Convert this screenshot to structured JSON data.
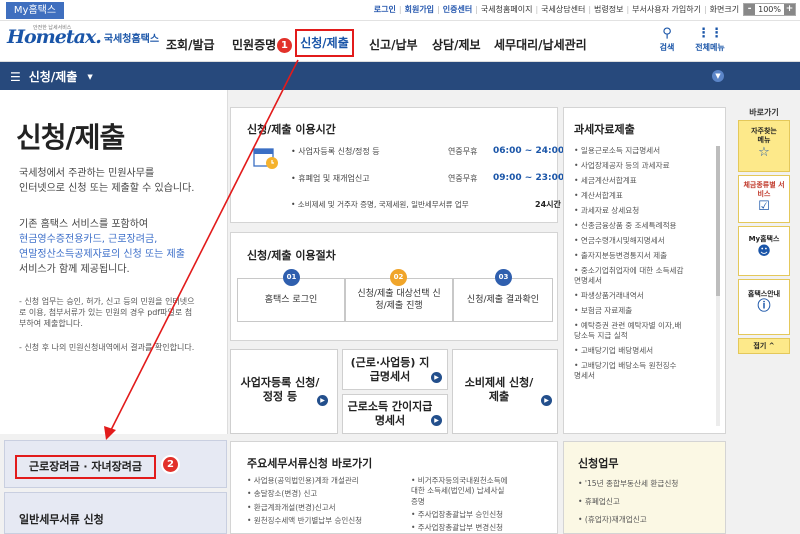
{
  "topbar": {
    "my_hometax": "My홈택스",
    "links": [
      "로그인",
      "회원가입",
      "인증센터",
      "국세청홈페이지",
      "국세상담센터",
      "법령정보",
      "부서사용자 가입하기",
      "화면크기"
    ],
    "zoom": "100%",
    "zoom_minus": "-",
    "zoom_plus": "+"
  },
  "header": {
    "logo_text": "Hometax.",
    "logo_org": "국세청홈택스",
    "logo_tiny": "안전한 납세서비스",
    "nav": [
      "조회/발급",
      "민원증명",
      "신청/제출",
      "신고/납부",
      "상담/제보",
      "세무대리/납세관리"
    ],
    "search_label": "검색",
    "allmenu_label": "전체메뉴"
  },
  "bluebar": {
    "menu_label": "신청/제출",
    "menu_icon": "hamburger-icon"
  },
  "left": {
    "page_title": "신청/제출",
    "intro": [
      "국세청에서 주관하는 민원사무를",
      "인터넷으로 신청 또는 제출할 수 있습니다."
    ],
    "info_line1": "기존 홈택스 서비스를 포함하여",
    "info_blue1": "현금영수증전용카드, 근로장려금,",
    "info_blue2": "연말정산소득공제자료의 신청 또는 제출",
    "info_line4": "서비스가 함께 제공됩니다.",
    "note1_lines": [
      "- 신청 업무는 승인, 허가, 신고 등의 민원을 인터넷으",
      "  로 이용, 첨부서류가 있는 민원의 경우 pdf파일로 첨",
      "  부하여 제출합니다."
    ],
    "note2": "- 신청 후 나의 민원신청내역에서 결과를 확인합니다.",
    "btn_eitc": "근로장려금 · 자녀장려금",
    "btn_general": "일반세무서류 신청"
  },
  "hours": {
    "title": "신청/제출 이용시간",
    "rows": [
      {
        "label": "• 사업자등록 신청/정정 등",
        "pre": "연중무휴",
        "time": "06:00 ~ 24:00"
      },
      {
        "label": "• 휴폐업 및 재개업신고",
        "pre": "연중무휴",
        "time": "09:00 ~ 23:00"
      },
      {
        "label": "• 소비제세 및 거주자 증명, 국제세원, 일반세무서류 업무",
        "time": "24시간"
      }
    ]
  },
  "procedure": {
    "title": "신청/제출 이용절차",
    "steps": [
      {
        "num": "01",
        "text": "홈택스 로그인"
      },
      {
        "num": "02",
        "text": "신청/제출 대상선택 신청/제출 진행"
      },
      {
        "num": "03",
        "text": "신청/제출 결과확인"
      }
    ]
  },
  "quick": {
    "biz_reg": "사업자등록 신청/정정 등",
    "wage_stmt": "(근로·사업등) 지급명세서",
    "simple_stmt": "근로소득 간이지급명세서",
    "consumption": "소비제세 신청/제출"
  },
  "major": {
    "title": "주요세무서류신청 바로가기",
    "col1": [
      "• 사업용(공익법인용)계좌 개설관리",
      "• 송달장소(변경) 신고",
      "• 환급계좌개설(변경)신고서",
      "• 원천징수세액 반기별납부 승인신청"
    ],
    "col2": [
      "• 비거주자등의국내원천소득에",
      "  대한 소득세(법인세) 납세사실",
      "  증명",
      "• 주사업장총괄납부 승인신청",
      "• 주사업장총괄납부 변경신청"
    ]
  },
  "taxdata": {
    "title": "과세자료제출",
    "items": [
      "• 일용근로소득 지급명세서",
      "• 사업장제공자 등의 과세자료",
      "• 세금계산서합계표",
      "• 계산서합계표",
      "• 과세자료 상세요청",
      "• 신종금융상품 중 조세특례적용",
      "• 연금수령개시및해지명세서",
      "• 출자지분등변경통지서 제출",
      "• 중소기업취업자에 대한 소득세감",
      "  면명세서",
      "• 파생상품거래내역서",
      "• 보험금 자료제출",
      "• 예탁증권 관련 예탁자별 이자,배",
      "  당소득 지급 실적",
      "• 고배당기업 배당명세서",
      "• 고배당기업 배당소득 원천징수",
      "  명세서"
    ]
  },
  "apply": {
    "title": "신청업무",
    "items": [
      "• '15년 종합부동산세 환급신청",
      "• 휴폐업신고",
      "• (휴업자)재개업신고"
    ]
  },
  "side": {
    "title": "바로가기",
    "items": [
      {
        "label": "자주찾는 메뉴",
        "icon": "star-icon"
      },
      {
        "label": "체금종류별 서비스",
        "icon": "check-icon"
      },
      {
        "label": "My홈택스",
        "icon": "person-icon"
      },
      {
        "label": "홈택스안내",
        "icon": "info-icon"
      }
    ],
    "close": "접기 ^"
  },
  "annotations": {
    "marker1": "1",
    "marker2": "2"
  },
  "colors": {
    "accent_red": "#e21b1b",
    "nav_blue": "#27497c",
    "brand_blue": "#1a55a8",
    "step1": "#2f5fae",
    "step2": "#f0a52a",
    "step3": "#2f5fae",
    "side_yellow": "#fde98a"
  }
}
